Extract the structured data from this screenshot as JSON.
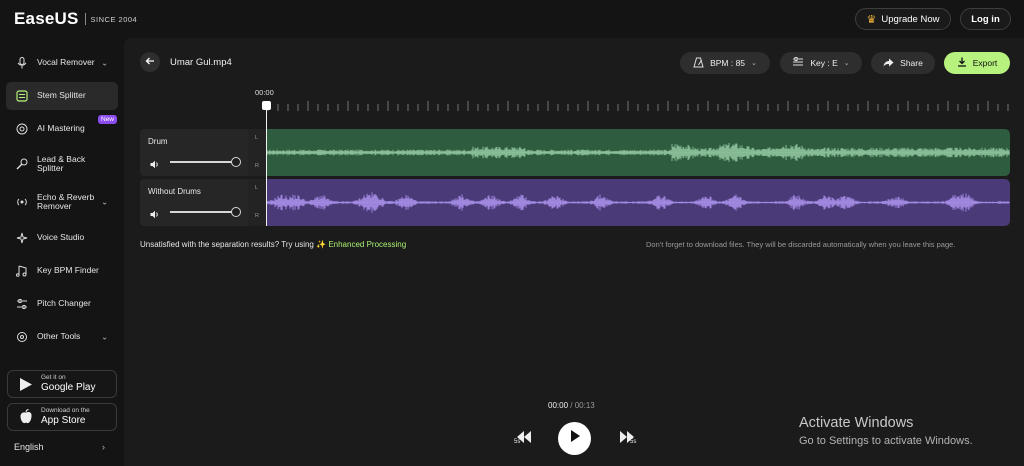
{
  "brand": {
    "logo": "EaseUS",
    "since": "SINCE 2004"
  },
  "header": {
    "upgrade_label": "Upgrade Now",
    "login_label": "Log in"
  },
  "sidebar": {
    "items": [
      {
        "label": "Vocal Remover",
        "icon": "microphone-icon",
        "has_chevron": true
      },
      {
        "label": "Stem Splitter",
        "icon": "stems-icon",
        "active": true
      },
      {
        "label": "AI Mastering",
        "icon": "mastering-icon",
        "badge": "New"
      },
      {
        "label": "Lead & Back Splitter",
        "icon": "mic-split-icon"
      },
      {
        "label": "Echo & Reverb Remover",
        "icon": "echo-icon",
        "has_chevron": true
      },
      {
        "label": "Voice Studio",
        "icon": "sparkle-icon"
      },
      {
        "label": "Key BPM Finder",
        "icon": "music-note-icon"
      },
      {
        "label": "Pitch Changer",
        "icon": "sliders-icon"
      },
      {
        "label": "Other Tools",
        "icon": "grid-icon",
        "has_chevron": true
      }
    ],
    "google_play": {
      "small": "Get it on",
      "big": "Google Play"
    },
    "app_store": {
      "small": "Download on the",
      "big": "App Store"
    },
    "language": "English"
  },
  "editor": {
    "file_name": "Umar Gul.mp4",
    "bpm_label": "BPM : 85",
    "key_label": "Key : E",
    "share_label": "Share",
    "export_label": "Export",
    "ruler_start": "00:00",
    "tracks": [
      {
        "name": "Drum",
        "color": "#2e5c3e",
        "wave_color": "#8fc49e",
        "volume": 1.0
      },
      {
        "name": "Without Drums",
        "color": "#4a3a78",
        "wave_color": "#a78ee8",
        "volume": 1.0
      }
    ],
    "channel_left": "L",
    "channel_right": "R",
    "hint_prefix": "Unsatisfied with the separation results? Try using",
    "hint_link": "Enhanced Processing",
    "hint_right": "Don't forget to download files. They will be discarded automatically when you leave this page.",
    "current_time": "00:00",
    "time_sep": "/",
    "total_time": "00:13"
  },
  "watermark": {
    "title": "Activate Windows",
    "subtitle": "Go to Settings to activate Windows."
  },
  "colors": {
    "accent": "#b6f27d",
    "badge": "#8c4cf0",
    "drum_track": "#2e5c3e",
    "nodrums_track": "#4a3a78"
  }
}
